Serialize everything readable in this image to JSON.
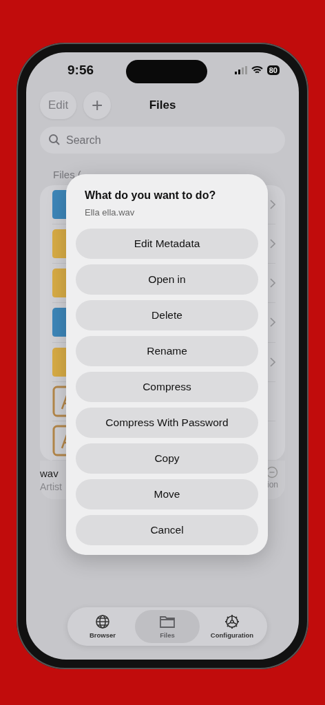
{
  "status_bar": {
    "time": "9:56",
    "battery": "80"
  },
  "nav": {
    "edit": "Edit",
    "add": "+",
    "title": "Files"
  },
  "search": {
    "placeholder": "Search"
  },
  "section_label": "Files (",
  "files": [
    {
      "kind": "folder",
      "color": "#3d86b8",
      "chevron": true
    },
    {
      "kind": "folder",
      "color": "#d8ab45",
      "chevron": true
    },
    {
      "kind": "folder",
      "color": "#d8ab45",
      "chevron": true
    },
    {
      "kind": "folder",
      "color": "#3d86b8",
      "chevron": true
    },
    {
      "kind": "folder",
      "color": "#d8ab45",
      "chevron": true
    },
    {
      "kind": "audio",
      "chevron": false
    },
    {
      "kind": "audio",
      "chevron": false
    }
  ],
  "mini_player": {
    "title": "wav",
    "artist": "Artist",
    "action": "ion"
  },
  "dialog": {
    "title": "What do you want to do?",
    "subtitle": "Ella ella.wav",
    "actions": [
      "Edit Metadata",
      "Open in",
      "Delete",
      "Rename",
      "Compress",
      "Compress With Password",
      "Copy",
      "Move",
      "Cancel"
    ]
  },
  "tabs": [
    {
      "label": "Browser",
      "selected": false
    },
    {
      "label": "Files",
      "selected": true
    },
    {
      "label": "Configuration",
      "selected": false
    }
  ]
}
